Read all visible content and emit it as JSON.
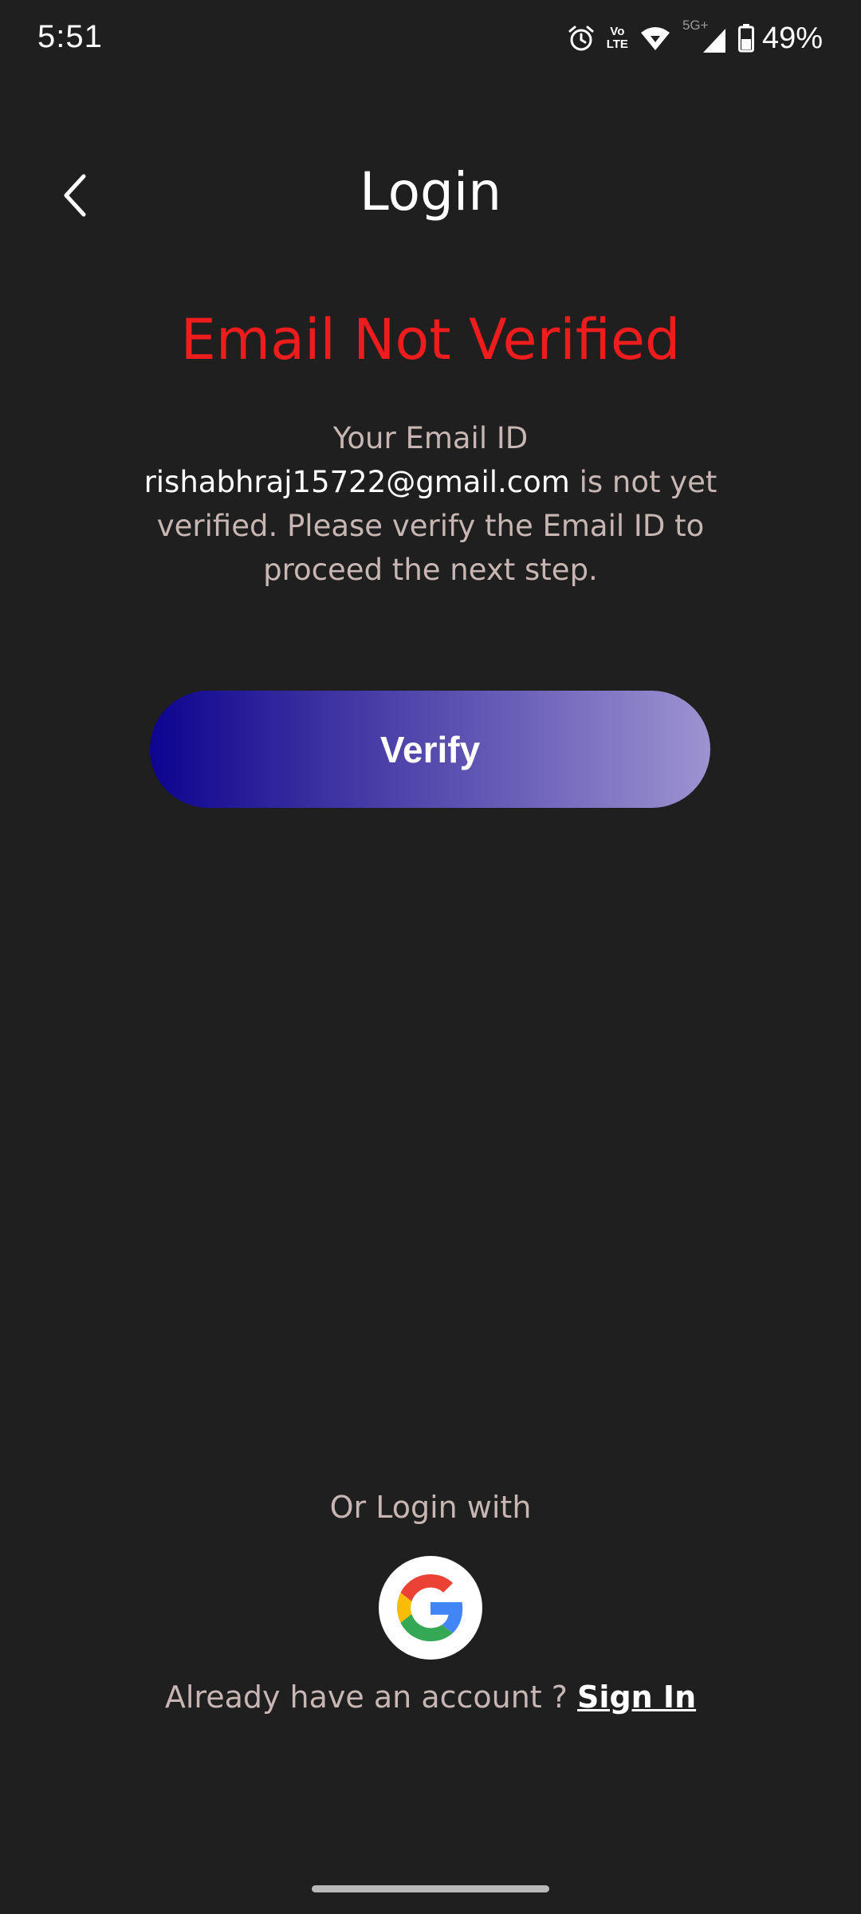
{
  "status_bar": {
    "time": "5:51",
    "network_label": "5G+",
    "volte_top": "Vo",
    "volte_bottom": "LTE",
    "battery": "49%",
    "icons": [
      "alarm-icon",
      "volte-icon",
      "wifi-icon",
      "signal-icon",
      "battery-icon"
    ]
  },
  "header": {
    "title": "Login",
    "back_icon": "chevron-left-icon"
  },
  "error": {
    "title": "Email Not Verified",
    "color": "#ee1c1c"
  },
  "message": {
    "prefix": "Your Email ID ",
    "email": "rishabhraj15722@gmail.com",
    "suffix": " is not yet verified. Please verify the Email ID to proceed the next step."
  },
  "verify_button": {
    "label": "Verify",
    "gradient_start": "#0d0490",
    "gradient_end": "#9d93d0"
  },
  "alt_login": {
    "label": "Or Login with",
    "provider_icon": "google-icon"
  },
  "account": {
    "prompt": "Already have an account ? ",
    "link": "Sign In"
  },
  "colors": {
    "background": "#1f1f1f",
    "muted_text": "#c7b6b3"
  }
}
